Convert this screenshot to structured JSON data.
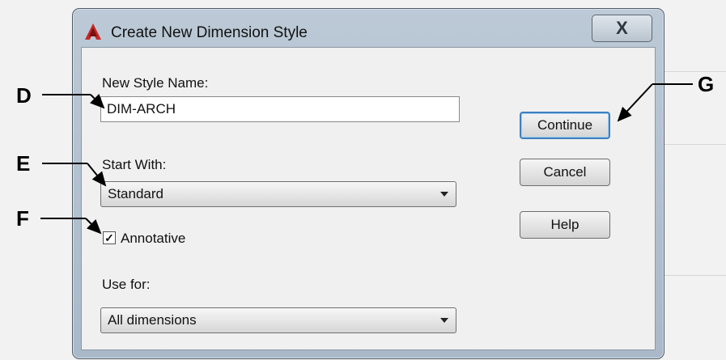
{
  "window": {
    "title": "Create New Dimension Style",
    "close_label": "X"
  },
  "form": {
    "style_name_label": "New Style Name:",
    "style_name_value": "DIM-ARCH",
    "start_with_label": "Start With:",
    "start_with_value": "Standard",
    "annotative_label": "Annotative",
    "annotative_checked": true,
    "use_for_label": "Use for:",
    "use_for_value": "All dimensions"
  },
  "buttons": {
    "continue": "Continue",
    "cancel": "Cancel",
    "help": "Help"
  },
  "callouts": {
    "d": "D",
    "e": "E",
    "f": "F",
    "g": "G"
  },
  "colors": {
    "callout_ink": "#000000",
    "default_button_border": "#3f7fbf"
  }
}
